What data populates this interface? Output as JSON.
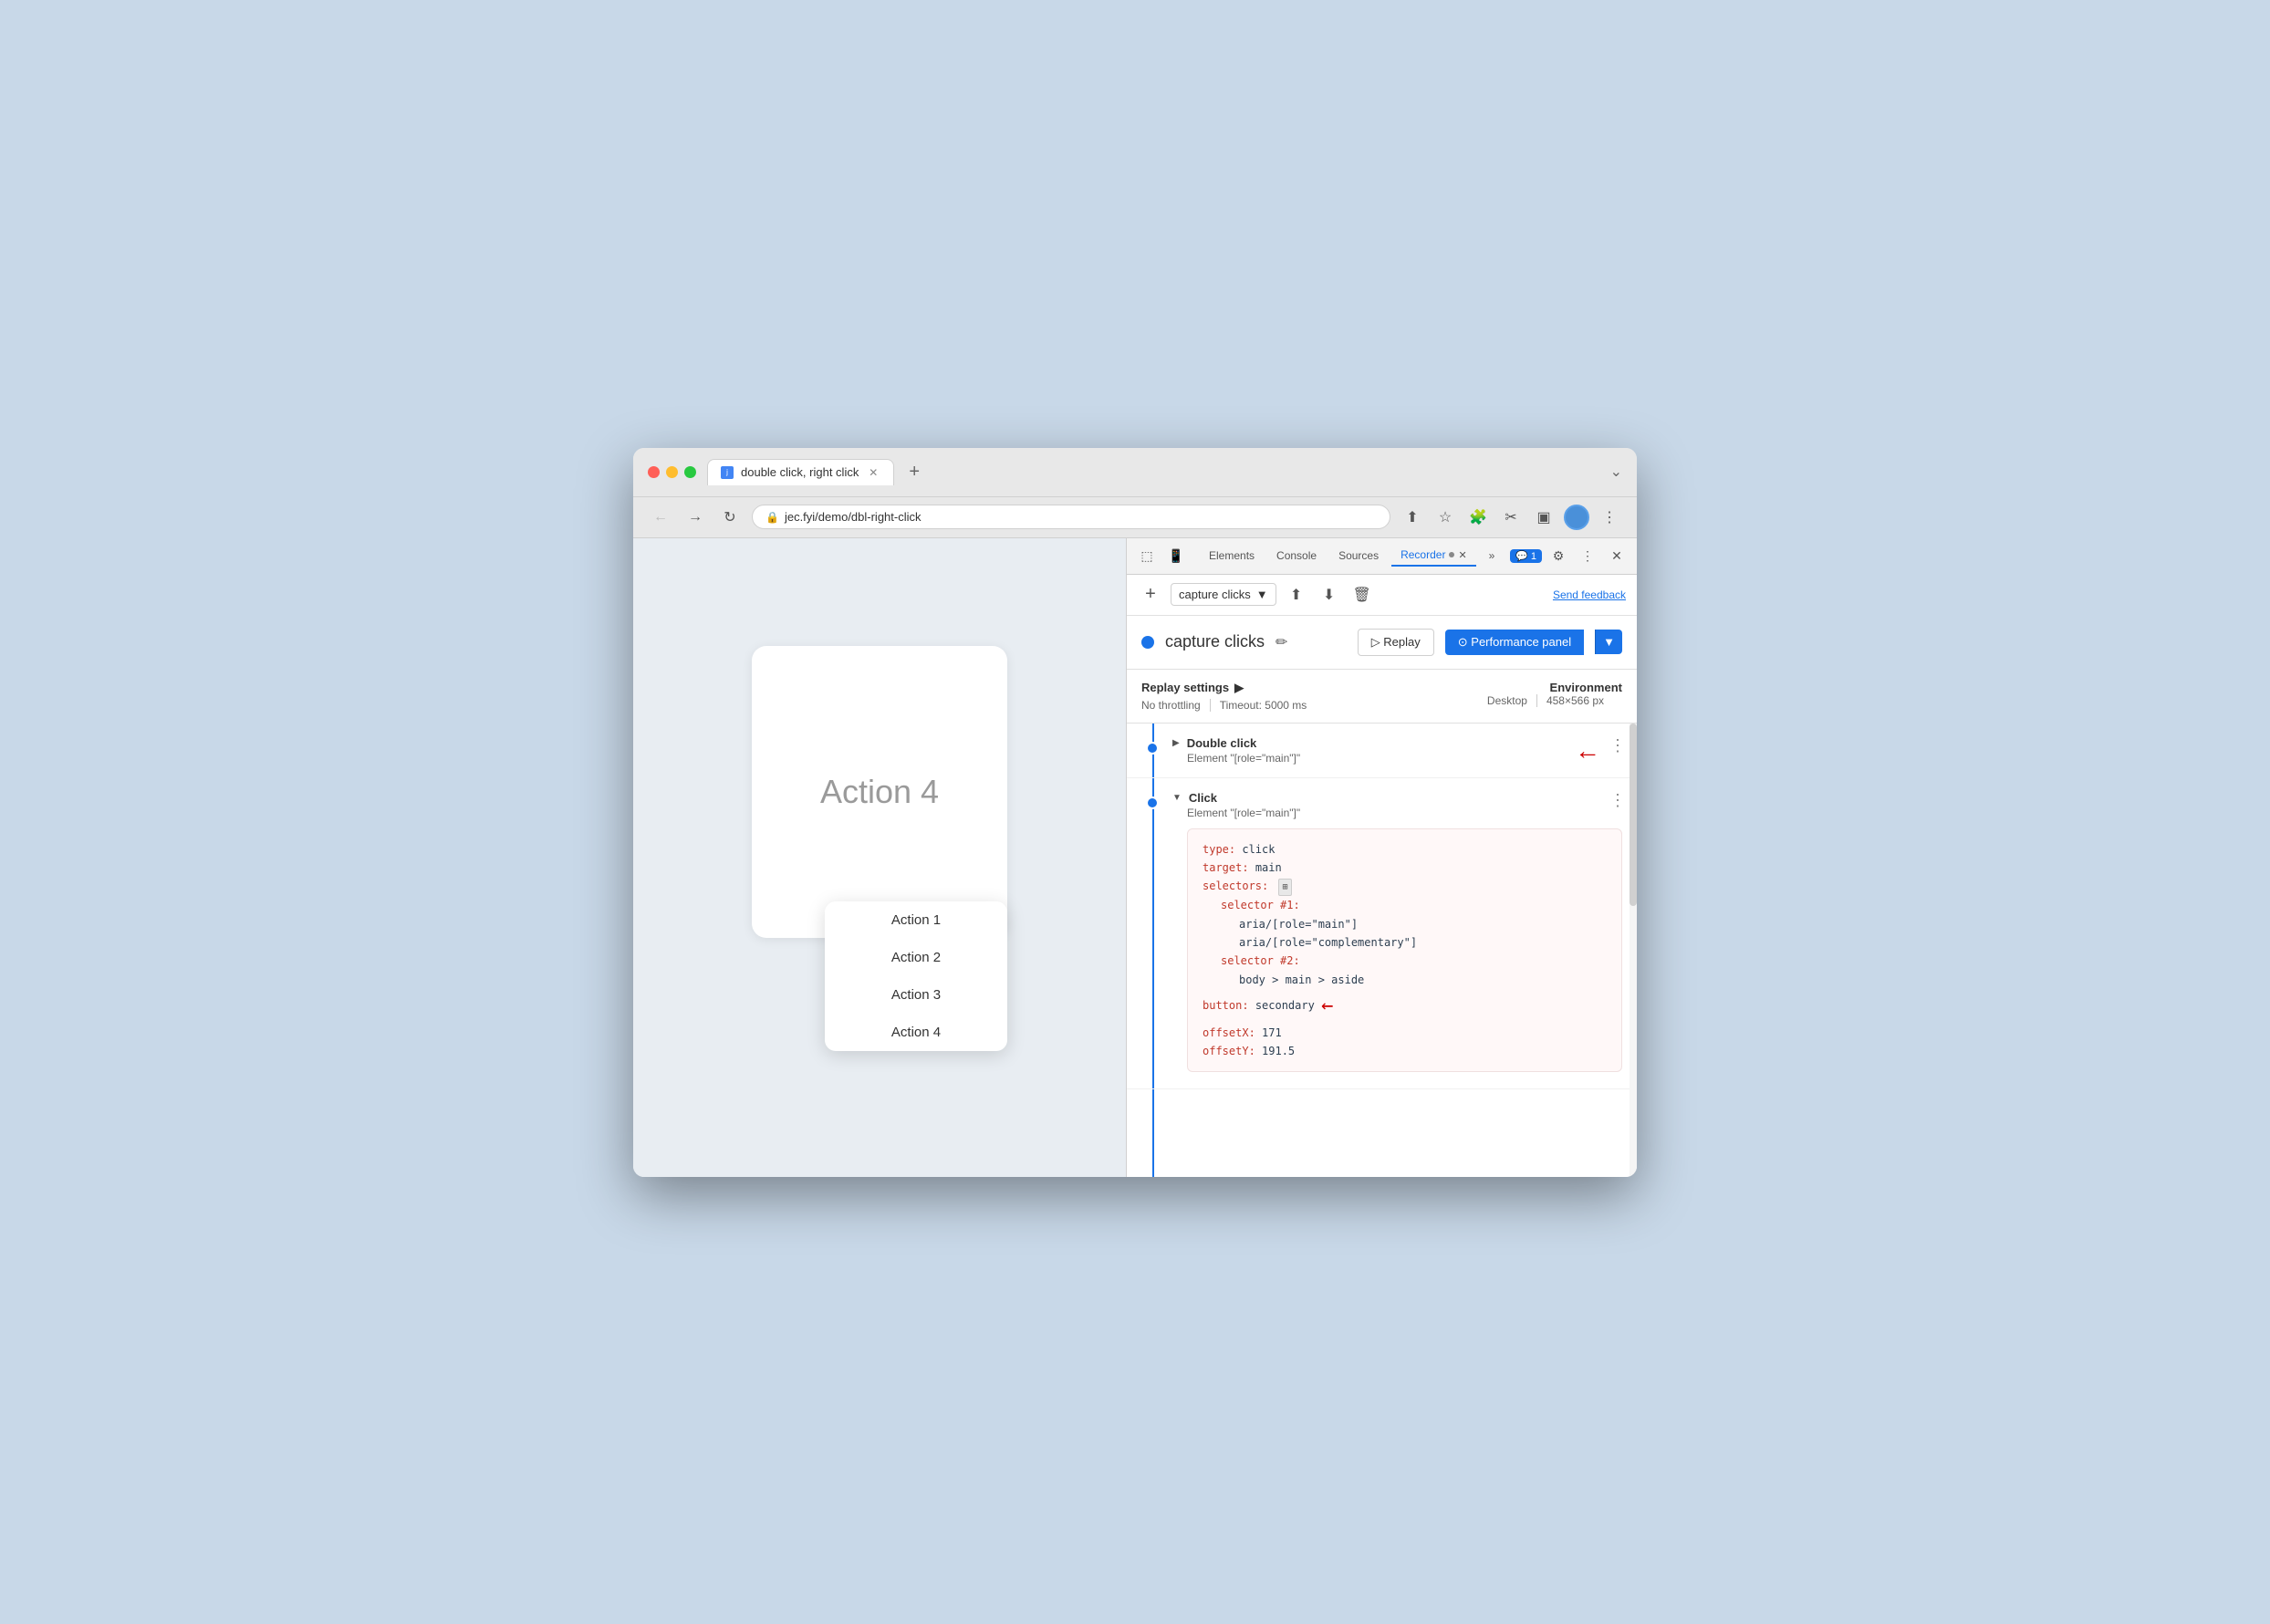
{
  "browser": {
    "tab_title": "double click, right click",
    "url": "jec.fyi/demo/dbl-right-click",
    "new_tab_label": "+",
    "more_icon": "⌄"
  },
  "devtools": {
    "tabs": [
      {
        "label": "Elements",
        "active": false
      },
      {
        "label": "Console",
        "active": false
      },
      {
        "label": "Sources",
        "active": false
      },
      {
        "label": "Recorder",
        "active": true
      },
      {
        "label": "»",
        "active": false
      }
    ],
    "comment_badge": "💬 1",
    "settings_icon": "⚙",
    "more_icon": "⋮",
    "close_icon": "✕"
  },
  "recorder": {
    "add_label": "+",
    "recording_name": "capture clicks",
    "dropdown_arrow": "▼",
    "export_icon": "⬆",
    "import_icon": "⬇",
    "delete_icon": "🗑",
    "send_feedback": "Send feedback",
    "recording_dot_color": "#1a73e8",
    "edit_icon": "✏",
    "replay_label": "▷  Replay",
    "performance_panel_label": "⊙  Performance panel",
    "performance_panel_dropdown": "▼"
  },
  "settings": {
    "replay_settings_label": "Replay settings",
    "expand_icon": "▶",
    "no_throttling": "No throttling",
    "timeout": "Timeout: 5000 ms",
    "environment_label": "Environment",
    "desktop_label": "Desktop",
    "resolution": "458×566 px"
  },
  "steps": [
    {
      "id": "step1",
      "type": "Double click",
      "element": "Element \"[role=\"main\"]\"",
      "expanded": false,
      "has_arrow": true
    },
    {
      "id": "step2",
      "type": "Click",
      "element": "Element \"[role=\"main\"]\"",
      "expanded": true,
      "has_arrow": false,
      "code": {
        "type_key": "type:",
        "type_val": " click",
        "target_key": "target:",
        "target_val": " main",
        "selectors_key": "selectors:",
        "selector1_key": "selector #1:",
        "aria_main": "aria/[role=\"main\"]",
        "aria_complementary": "aria/[role=\"complementary\"]",
        "selector2_key": "selector #2:",
        "body_selector": "body > main > aside",
        "button_key": "button:",
        "button_val": " secondary",
        "offsetX_key": "offsetX:",
        "offsetX_val": " 171",
        "offsetY_key": "offsetY:",
        "offsetY_val": " 191.5"
      },
      "has_code_arrow": true
    }
  ],
  "page": {
    "main_card_text": "Action 4",
    "menu_items": [
      "Action 1",
      "Action 2",
      "Action 3",
      "Action 4"
    ]
  }
}
